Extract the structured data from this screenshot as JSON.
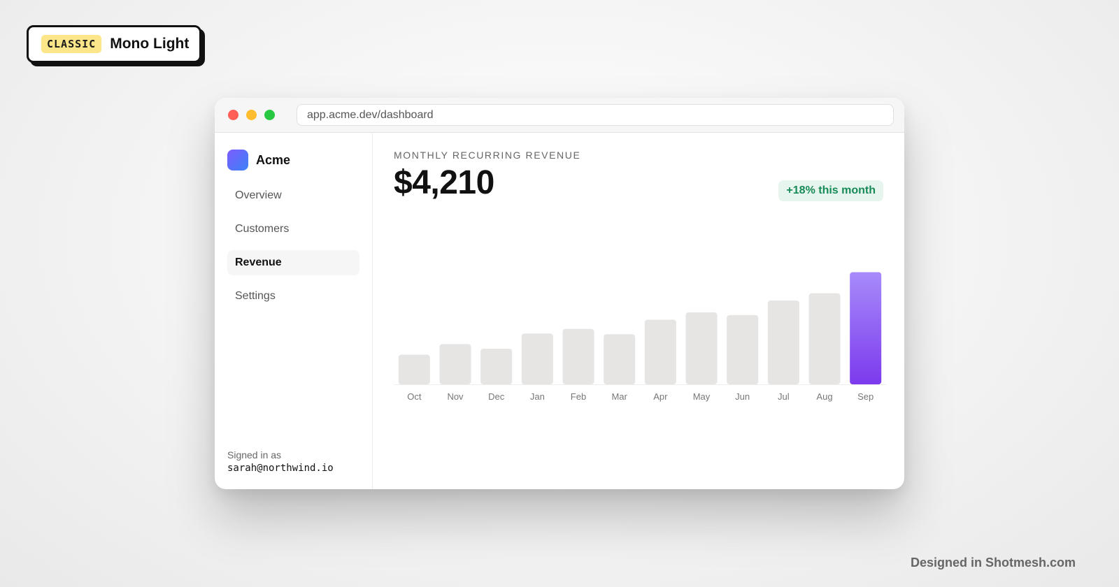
{
  "theme": {
    "tag": "CLASSIC",
    "name": "Mono Light"
  },
  "browser": {
    "url": "app.acme.dev/dashboard"
  },
  "sidebar": {
    "brand": "Acme",
    "items": [
      {
        "label": "Overview",
        "active": false
      },
      {
        "label": "Customers",
        "active": false
      },
      {
        "label": "Revenue",
        "active": true
      },
      {
        "label": "Settings",
        "active": false
      }
    ],
    "signed_in_label": "Signed in as",
    "signed_in_email": "sarah@northwind.io"
  },
  "metric": {
    "label": "MONTHLY RECURRING REVENUE",
    "value": "$4,210",
    "delta": "+18% this month",
    "delta_color": "#168a57"
  },
  "chart_data": {
    "type": "bar",
    "categories": [
      "Oct",
      "Nov",
      "Dec",
      "Jan",
      "Feb",
      "Mar",
      "Apr",
      "May",
      "Jun",
      "Jul",
      "Aug",
      "Sep"
    ],
    "values": [
      45,
      61,
      54,
      77,
      84,
      76,
      98,
      109,
      105,
      127,
      138,
      170
    ],
    "highlight_index": 11,
    "bar_color": "#e6e5e4",
    "highlight_color": "#7c3aed",
    "ylim": [
      0,
      180
    ],
    "grid": false
  },
  "footer": {
    "credit": "Designed in Shotmesh.com"
  }
}
